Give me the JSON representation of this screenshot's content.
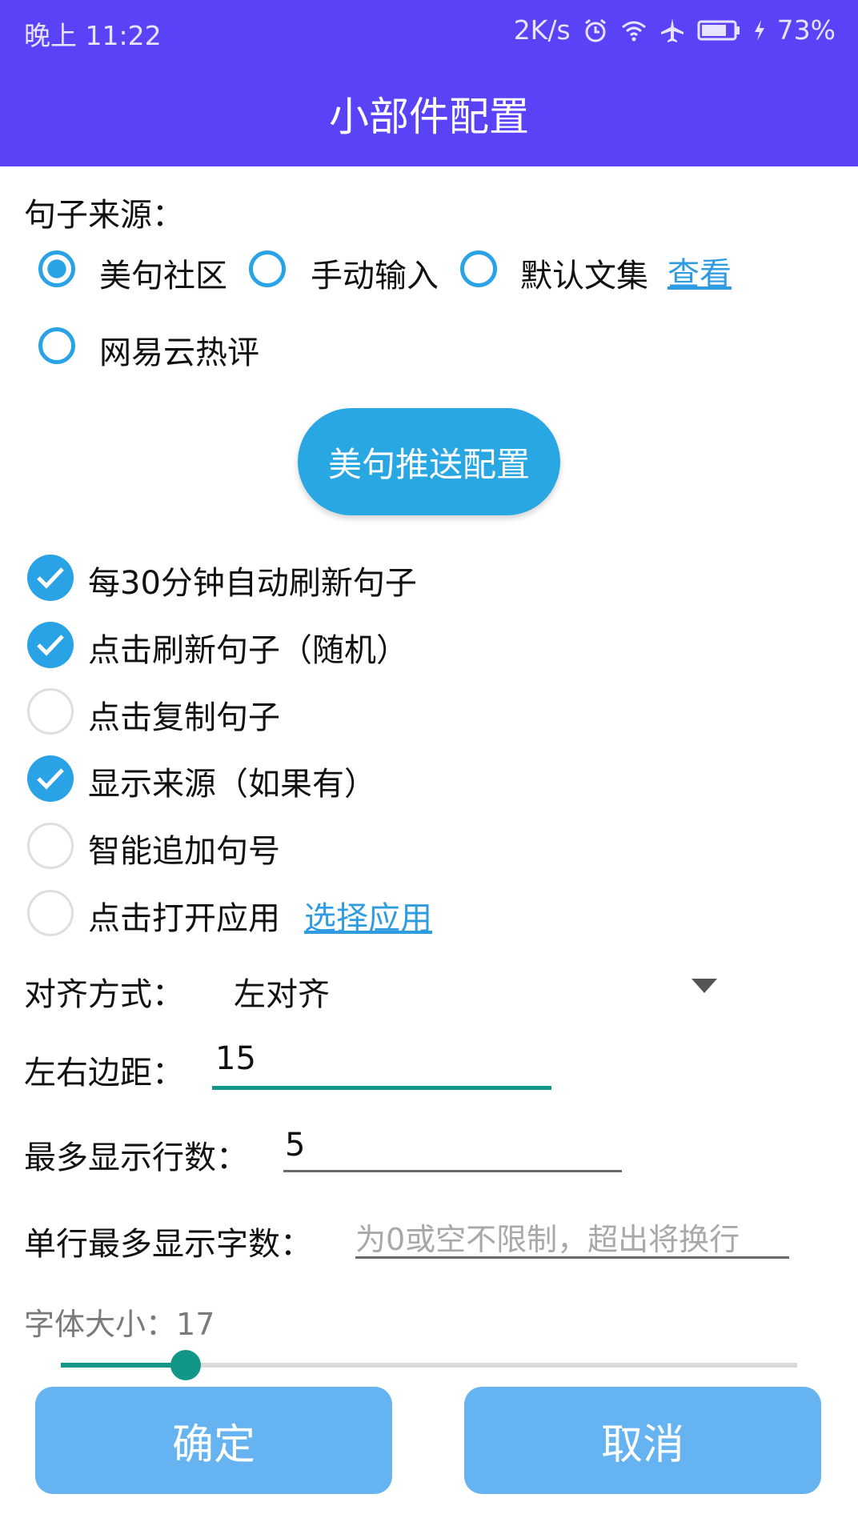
{
  "status_bar": {
    "time": "晚上 11:22",
    "net_speed": "2K/s",
    "battery": "73%",
    "icons": [
      "alarm-icon",
      "wifi-icon",
      "airplane-icon",
      "battery-icon",
      "charging-icon"
    ]
  },
  "app_bar": {
    "title": "小部件配置"
  },
  "source": {
    "label": "句子来源：",
    "options": [
      "美句社区",
      "手动输入",
      "默认文集",
      "网易云热评"
    ],
    "selected": "美句社区",
    "view_link": "查看"
  },
  "push_button": "美句推送配置",
  "options": [
    {
      "label": "每30分钟自动刷新句子",
      "checked": true
    },
    {
      "label": "点击刷新句子（随机）",
      "checked": true
    },
    {
      "label": "点击复制句子",
      "checked": false
    },
    {
      "label": "显示来源（如果有）",
      "checked": true
    },
    {
      "label": "智能追加句号",
      "checked": false
    },
    {
      "label": "点击打开应用",
      "checked": false
    }
  ],
  "select_app_link": "选择应用",
  "align": {
    "label": "对齐方式：",
    "value": "左对齐"
  },
  "margin": {
    "label": "左右边距：",
    "value": "15"
  },
  "max_lines": {
    "label": "最多显示行数：",
    "value": "5"
  },
  "max_chars": {
    "label": "单行最多显示字数：",
    "placeholder": "为0或空不限制，超出将换行",
    "value": ""
  },
  "font_size": {
    "label": "字体大小：",
    "value": "17",
    "slider_fraction": 0.17
  },
  "buttons": {
    "ok": "确定",
    "cancel": "取消"
  },
  "colors": {
    "primary": "#5a43f6",
    "accent": "#2aa3e6",
    "focus": "#119688",
    "button": "#66b3f1"
  }
}
